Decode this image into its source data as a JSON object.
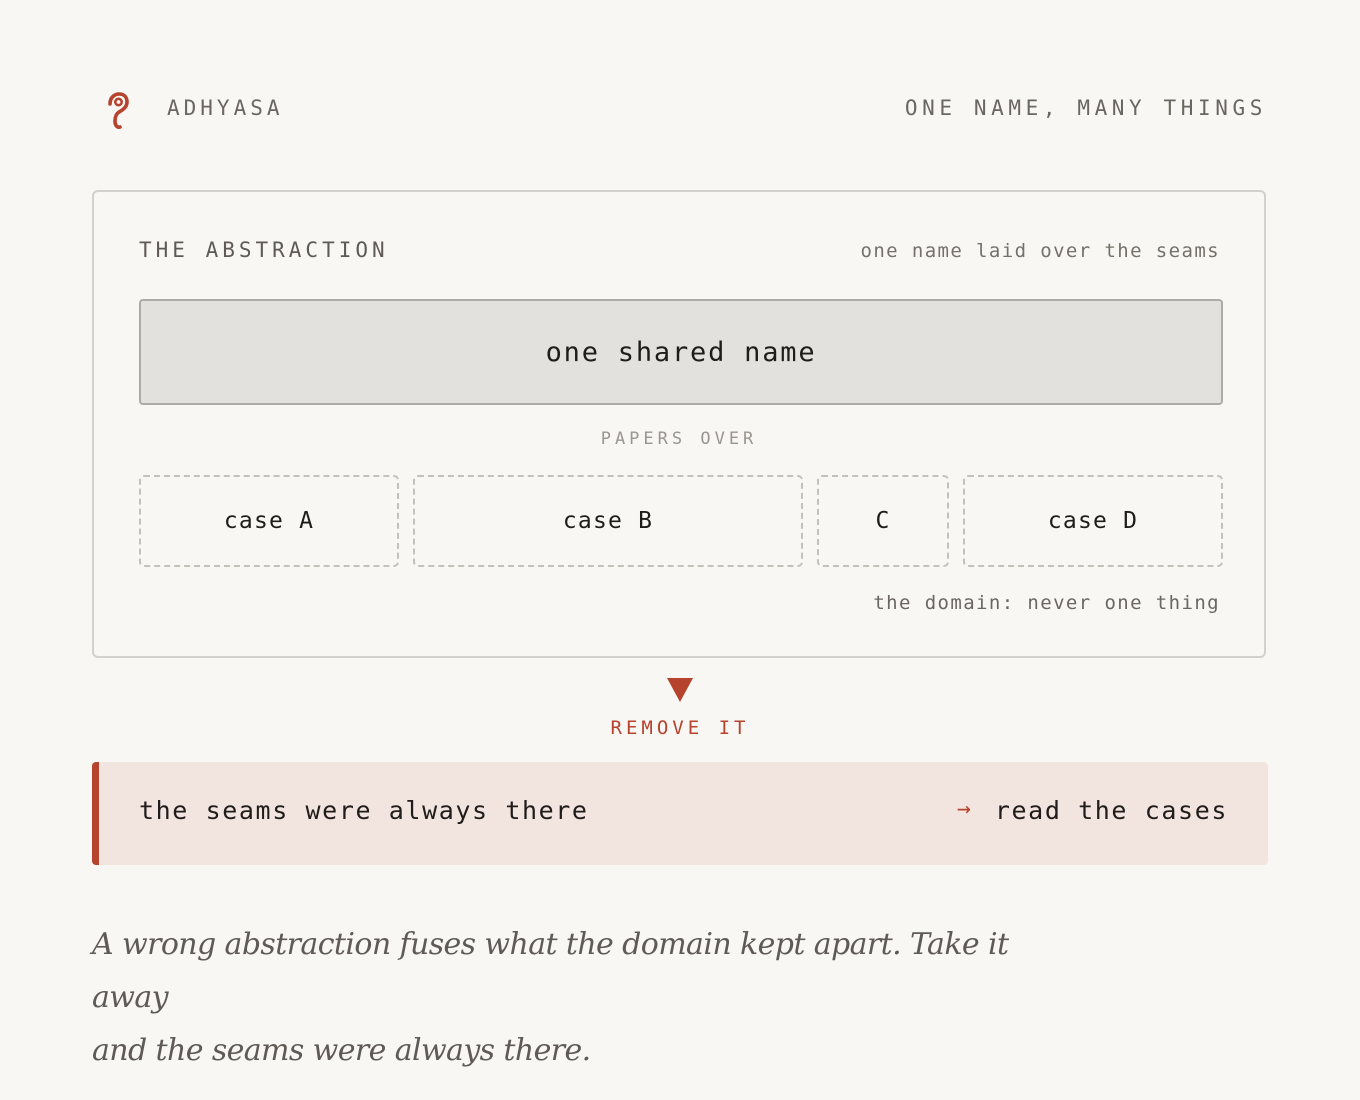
{
  "header": {
    "brand_icon": "hook-glyph-icon",
    "brand_name": "ADHYASA",
    "tagline": "ONE NAME, MANY THINGS"
  },
  "panel": {
    "title": "THE ABSTRACTION",
    "note": "one name laid over the seams",
    "shared_name": "one shared name",
    "connector_label": "PAPERS OVER",
    "cases": [
      {
        "label": "case A"
      },
      {
        "label": "case B"
      },
      {
        "label": "C"
      },
      {
        "label": "case D"
      }
    ],
    "domain_note": "the domain: never one thing"
  },
  "transition": {
    "icon": "down-triangle-icon",
    "label": "REMOVE IT"
  },
  "result": {
    "text": "the seams were always there",
    "arrow": "→",
    "action": "read the cases"
  },
  "caption": {
    "line1": "A wrong abstraction fuses what the domain kept apart. Take it away",
    "line2": "and the seams were always there."
  },
  "colors": {
    "background": "#f9f7f3",
    "accent": "#b5432e",
    "shared_fill": "#e3e1dd",
    "result_fill": "#f2e4df",
    "muted_text": "#6b6661"
  }
}
